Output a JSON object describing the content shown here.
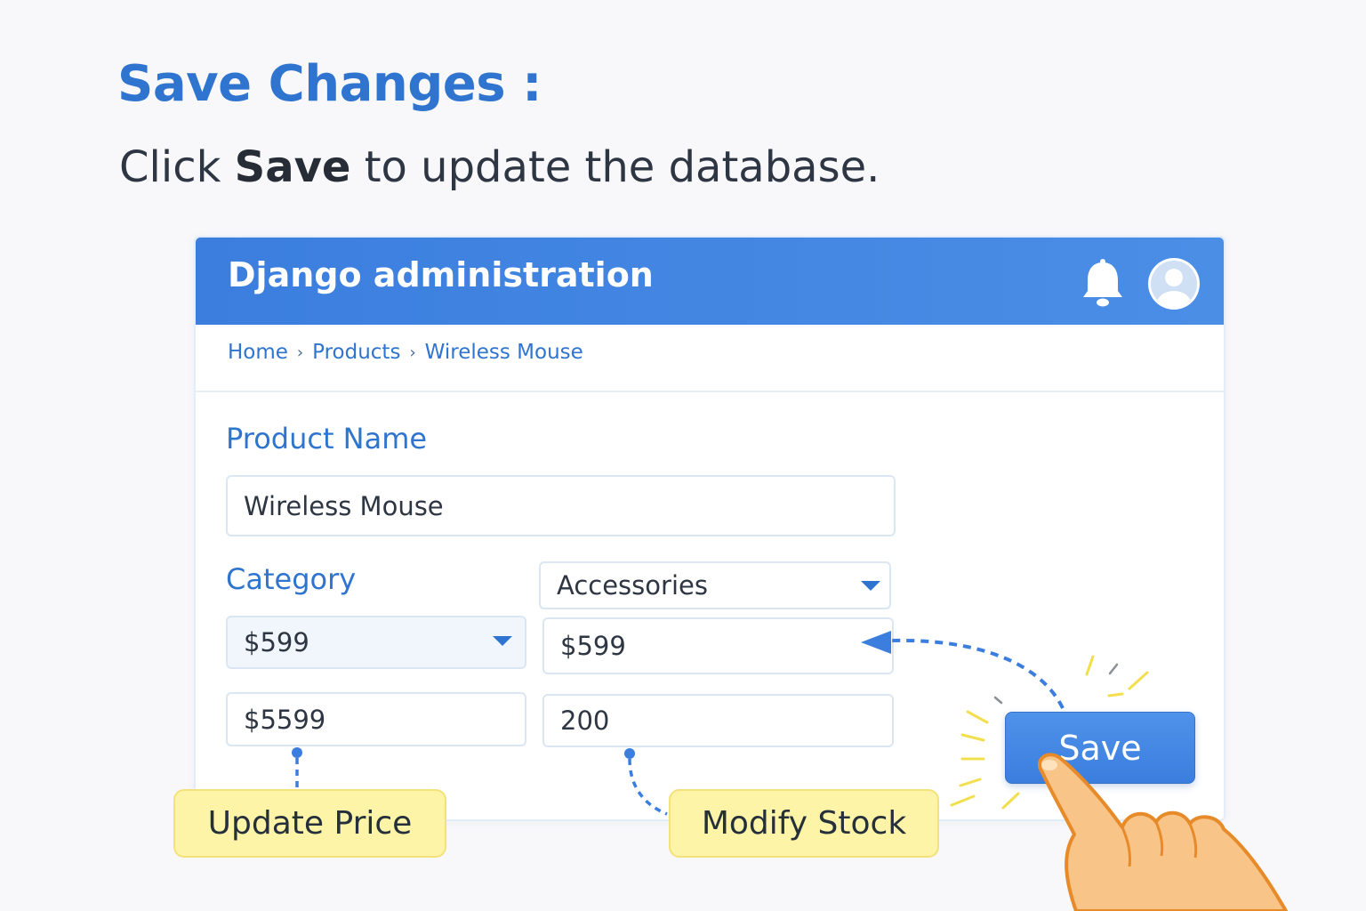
{
  "heading": {
    "title": "Save Changes :",
    "instruction_prefix": "Click",
    "instruction_bold": "Save",
    "instruction_suffix": "to update the database."
  },
  "admin": {
    "title": "Django administration",
    "header_color": "#3b7ede",
    "breadcrumb": [
      "Home",
      "Products",
      "Wireless Mouse"
    ],
    "form": {
      "product_name_label": "Product Name",
      "product_name_value": "Wireless Mouse",
      "category_label": "Category",
      "category_value": "Accessories",
      "price_select_value": "$599",
      "price_input_value": "$599",
      "price_extra_value": "$5599",
      "stock_value": "200"
    },
    "save_label": "Save"
  },
  "callouts": {
    "update_price": "Update Price",
    "modify_stock": "Modify Stock"
  },
  "icons": {
    "bell": "bell-icon",
    "avatar": "user-avatar-icon",
    "caret": "chevron-down-icon",
    "hand": "pointing-hand-icon"
  },
  "colors": {
    "accent": "#2f74cf",
    "callout_fill": "#fdf4a8"
  }
}
